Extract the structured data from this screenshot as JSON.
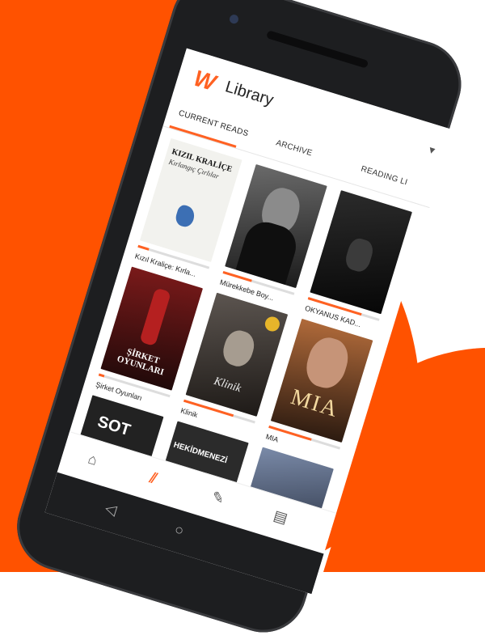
{
  "colors": {
    "accent": "#ff6122",
    "phone": "#1d1e20"
  },
  "header": {
    "logo": "W",
    "title": "Library",
    "caret": "▼"
  },
  "tabs": [
    {
      "label": "CURRENT READS",
      "active": true
    },
    {
      "label": "ARCHIVE",
      "active": false
    },
    {
      "label": "READING LI",
      "active": false
    }
  ],
  "books": [
    {
      "title": "Kızıl Kraliçe: Kırla...",
      "cover_text": "KIZIL KRALİÇE",
      "cover_sub": "Kırlangıç Çırlılar",
      "progress": 0.15,
      "cover_color": "#f2f2ee"
    },
    {
      "title": "Mürekkebe Boy...",
      "cover_text": "",
      "progress": 0.4,
      "cover_color": "#2d2d2d"
    },
    {
      "title": "OKYANUS KAD...",
      "cover_text": "",
      "progress": 0.75,
      "cover_color": "#161616"
    },
    {
      "title": "Şirket Oyunları",
      "cover_text": "ŞİRKET OYUNLARI",
      "progress": 0.08,
      "cover_color": "#4a1414"
    },
    {
      "title": "Klinik",
      "cover_text": "Klinik",
      "progress": 0.7,
      "cover_color": "#3c3530"
    },
    {
      "title": "MIA",
      "cover_text": "MIA",
      "progress": 0.6,
      "cover_color": "#5a3a22"
    },
    {
      "title": "",
      "cover_text": "SOT",
      "progress": 0,
      "cover_color": "#222222"
    },
    {
      "title": "",
      "cover_text": "HEKİDMENEZİ",
      "progress": 0,
      "cover_color": "#2b2b2b"
    },
    {
      "title": "",
      "cover_text": "",
      "progress": 0,
      "cover_color": "#51607a"
    }
  ],
  "bottom_nav": [
    {
      "icon": "home-icon",
      "glyph": "⌂"
    },
    {
      "icon": "library-icon",
      "glyph": "⫽"
    },
    {
      "icon": "write-icon",
      "glyph": "✎"
    },
    {
      "icon": "chat-icon",
      "glyph": "▤"
    }
  ],
  "system_nav": {
    "back": "◁",
    "home": "○"
  }
}
